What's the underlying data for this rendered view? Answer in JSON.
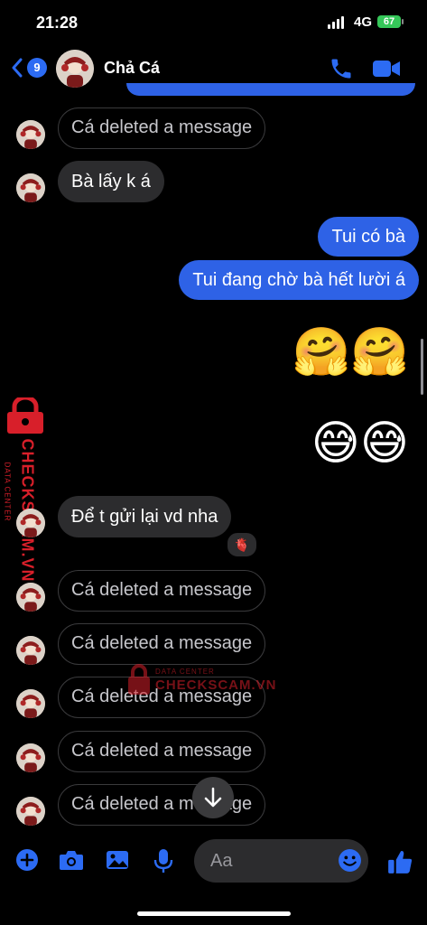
{
  "status": {
    "time": "21:28",
    "network": "4G",
    "battery": "67"
  },
  "header": {
    "unread_count": "9",
    "contact_name": "Chả Cá"
  },
  "messages": [
    {
      "text": "Cá deleted a message"
    },
    {
      "text": "Bà lấy k á"
    },
    {
      "text": "Tui có bà"
    },
    {
      "text": "Tui đang chờ bà hết lười á"
    },
    {
      "emoji": "🤗🤗"
    },
    {
      "emoji": "😅😅"
    },
    {
      "text": "Để t gửi lại vd nha",
      "reaction": "🫀"
    },
    {
      "text": "Cá deleted a message"
    },
    {
      "text": "Cá deleted a message"
    },
    {
      "text": "Cá deleted a message"
    },
    {
      "text": "Cá deleted a message"
    },
    {
      "text": "Cá deleted a message"
    }
  ],
  "watermark": {
    "brand": "CHECKSCAM.VN",
    "sub": "DATA CENTER"
  },
  "composer": {
    "placeholder": "Aa"
  },
  "colors": {
    "accent": "#2e62e6",
    "icon_blue": "#2c6bf3",
    "watermark": "#d81f2a"
  },
  "icons": [
    "back-chevron-icon",
    "phone-icon",
    "video-camera-icon",
    "plus-icon",
    "camera-icon",
    "image-icon",
    "microphone-icon",
    "smiley-icon",
    "thumbs-up-icon",
    "arrow-down-icon",
    "lock-icon"
  ]
}
